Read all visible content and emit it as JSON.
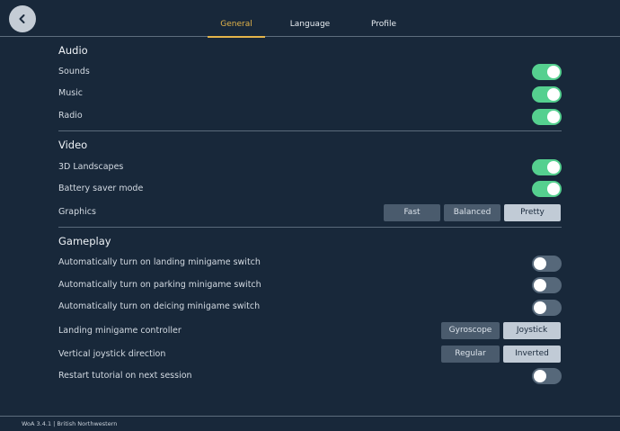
{
  "header": {
    "tabs": [
      {
        "label": "General",
        "active": true
      },
      {
        "label": "Language",
        "active": false
      },
      {
        "label": "Profile",
        "active": false
      }
    ],
    "back_icon": "chevron-left-icon"
  },
  "audio": {
    "title": "Audio",
    "sounds": {
      "label": "Sounds",
      "on": true
    },
    "music": {
      "label": "Music",
      "on": true
    },
    "radio": {
      "label": "Radio",
      "on": true
    }
  },
  "video": {
    "title": "Video",
    "landscapes": {
      "label": "3D Landscapes",
      "on": true
    },
    "battery": {
      "label": "Battery saver mode",
      "on": true
    },
    "graphics": {
      "label": "Graphics",
      "options": [
        "Fast",
        "Balanced",
        "Pretty"
      ],
      "selected": "Pretty"
    }
  },
  "gameplay": {
    "title": "Gameplay",
    "landing_switch": {
      "label": "Automatically turn on landing minigame switch",
      "on": false
    },
    "parking_switch": {
      "label": "Automatically turn on parking minigame switch",
      "on": false
    },
    "deicing_switch": {
      "label": "Automatically turn on deicing minigame switch",
      "on": false
    },
    "controller": {
      "label": "Landing minigame controller",
      "options": [
        "Gyroscope",
        "Joystick"
      ],
      "selected": "Joystick"
    },
    "joystick_direction": {
      "label": "Vertical joystick direction",
      "options": [
        "Regular",
        "Inverted"
      ],
      "selected": "Inverted"
    },
    "restart_tutorial": {
      "label": "Restart tutorial on next session",
      "on": false
    }
  },
  "footer": {
    "version": "WoA 3.4.1 | British Northwestern"
  },
  "colors": {
    "background": "#18283a",
    "accent": "#e3b44a",
    "toggle_on": "#55d08f",
    "toggle_off": "#56687a"
  }
}
